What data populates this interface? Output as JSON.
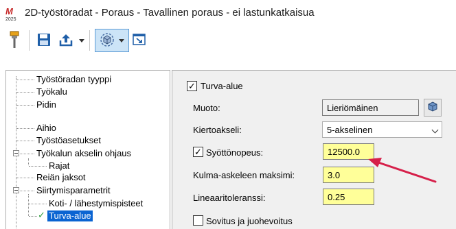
{
  "window": {
    "title": "2D-työstöradat - Poraus - Tavallinen poraus - ei lastunkatkaisua",
    "logo_text": "2025"
  },
  "toolbar": {
    "items": [
      {
        "icon": "tool-holder-icon"
      },
      {
        "icon": "save-icon"
      },
      {
        "icon": "export-icon"
      },
      {
        "icon": "view-cube-icon"
      },
      {
        "icon": "maximize-icon"
      }
    ]
  },
  "tree": {
    "items": [
      {
        "label": "Työstöradan tyyppi"
      },
      {
        "label": "Työkalu"
      },
      {
        "label": "Pidin"
      },
      {
        "label": "Aihio"
      },
      {
        "label": "Työstöasetukset"
      },
      {
        "label": "Työkalun akselin ohjaus"
      },
      {
        "label": "Rajat"
      },
      {
        "label": "Reiän jaksot"
      },
      {
        "label": "Siirtymisparametrit"
      },
      {
        "label": "Koti- / lähestymispisteet"
      },
      {
        "label": "Turva-alue"
      }
    ],
    "selected_index": 10
  },
  "form": {
    "section_checkbox_label": "Turva-alue",
    "section_checked": true,
    "shape_label": "Muoto:",
    "shape_value": "Lieriömäinen",
    "rotation_axis_label": "Kiertoakseli:",
    "rotation_axis_value": "5-akselinen",
    "feedrate_label": "Syöttönopeus:",
    "feedrate_checked": true,
    "feedrate_value": "12500.0",
    "max_angle_step_label": "Kulma-askeleen maksimi:",
    "max_angle_step_value": "3.0",
    "linear_tolerance_label": "Lineaaritoleranssi:",
    "linear_tolerance_value": "0.25",
    "fit_smooth_label": "Sovitus ja juohevoitus",
    "fit_smooth_checked": false
  },
  "colors": {
    "highlight_field": "#ffff99",
    "selection": "#0a64d2",
    "annotation_arrow": "#d6204a"
  }
}
